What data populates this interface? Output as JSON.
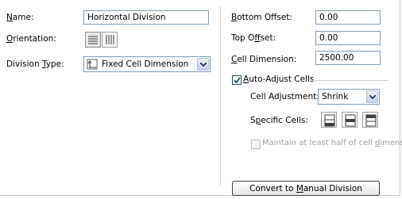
{
  "left": {
    "name_label": "Name:",
    "name_value": "Horizontal Division",
    "orientation_label": "Orientation:",
    "orientation_buttons": [
      {
        "icon": "horizontal-lines-icon",
        "selected": true
      },
      {
        "icon": "vertical-lines-icon",
        "selected": false
      }
    ],
    "division_type_label": "Division Type:",
    "division_type_value": "Fixed Cell Dimension",
    "division_type_icon": "fixed-cell-dimension-icon"
  },
  "right": {
    "bottom_offset_label": "Bottom Offset:",
    "bottom_offset_value": "0.00",
    "top_offset_label": "Top Offset:",
    "top_offset_value": "0.00",
    "cell_dimension_label": "Cell Dimension:",
    "cell_dimension_value": "2500.00",
    "auto_adjust_label": "Auto-Adjust Cells",
    "auto_adjust_checked": true,
    "cell_adjustment_label": "Cell Adjustment:",
    "cell_adjustment_value": "Shrink",
    "specific_cells_label": "Specific Cells:",
    "specific_cells_buttons": [
      "cell-bottom-icon",
      "cell-middle-icon",
      "cell-top-icon"
    ],
    "maintain_label": "Maintain at least half of cell dimension",
    "maintain_checked": false,
    "maintain_enabled": false,
    "convert_button_label": "Convert to Manual Division"
  },
  "colors": {
    "field_border": "#7f9db9",
    "disabled_text": "#a0a0a0",
    "check_color": "#1c5180"
  }
}
